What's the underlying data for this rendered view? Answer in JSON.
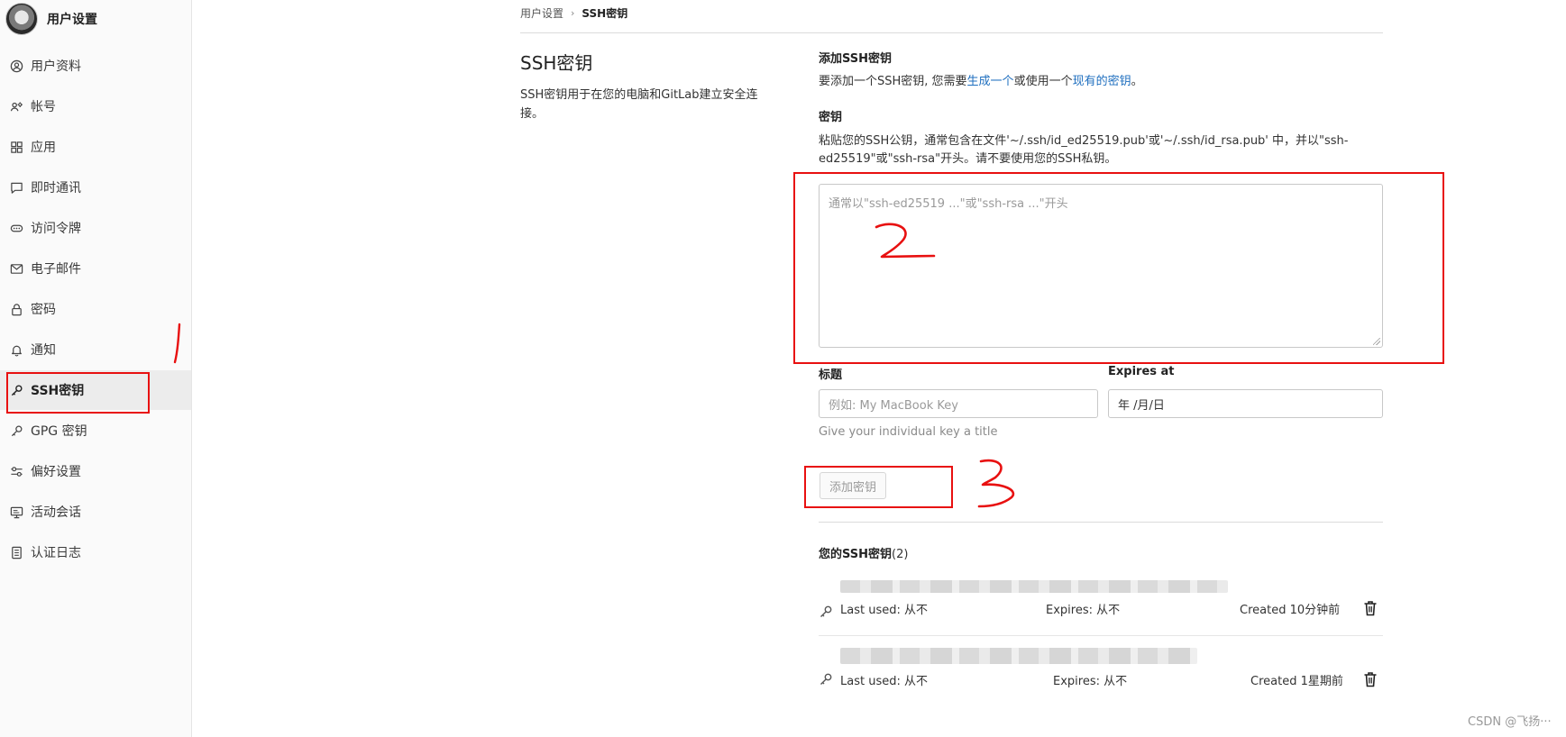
{
  "sidebar": {
    "title": "用户设置",
    "items": [
      {
        "label": "用户资料",
        "icon": "profile-icon"
      },
      {
        "label": "帐号",
        "icon": "account-icon"
      },
      {
        "label": "应用",
        "icon": "applications-icon"
      },
      {
        "label": "即时通讯",
        "icon": "chat-icon"
      },
      {
        "label": "访问令牌",
        "icon": "token-icon"
      },
      {
        "label": "电子邮件",
        "icon": "mail-icon"
      },
      {
        "label": "密码",
        "icon": "lock-icon"
      },
      {
        "label": "通知",
        "icon": "bell-icon"
      },
      {
        "label": "SSH密钥",
        "icon": "key-icon",
        "active": true
      },
      {
        "label": "GPG 密钥",
        "icon": "key-icon"
      },
      {
        "label": "偏好设置",
        "icon": "preferences-icon"
      },
      {
        "label": "活动会话",
        "icon": "monitor-icon"
      },
      {
        "label": "认证日志",
        "icon": "log-icon"
      }
    ]
  },
  "breadcrumb": {
    "parent": "用户设置",
    "current": "SSH密钥"
  },
  "intro": {
    "title": "SSH密钥",
    "description": "SSH密钥用于在您的电脑和GitLab建立安全连接。"
  },
  "add_key": {
    "heading": "添加SSH密钥",
    "text_prefix": "要添加一个SSH密钥, 您需要",
    "link_generate": "生成一个",
    "text_middle": "或使用一个",
    "link_existing": "现有的密钥",
    "text_suffix": "。",
    "key_label": "密钥",
    "key_help_line1": "粘贴您的SSH公钥，通常包含在文件'~/.ssh/id_ed25519.pub'或'~/.ssh/id_rsa.pub' 中，并以\"ssh-",
    "key_help_line2": "ed25519\"或\"ssh-rsa\"开头。请不要使用您的SSH私钥。",
    "key_placeholder": "通常以\"ssh-ed25519 ...\"或\"ssh-rsa ...\"开头",
    "title_label": "标题",
    "title_placeholder": "例如: My MacBook Key",
    "expires_label": "Expires at",
    "expires_value": "年 /月/日",
    "title_hint": "Give your individual key a title",
    "submit_label": "添加密钥"
  },
  "keys_list": {
    "heading": "您的SSH密钥",
    "count": "(2)",
    "keys": [
      {
        "last_used": "Last used: 从不",
        "expires": "Expires: 从不",
        "created": "Created 10分钟前"
      },
      {
        "last_used": "Last used: 从不",
        "expires": "Expires: 从不",
        "created": "Created 1星期前"
      }
    ]
  },
  "annotations": {
    "mark1": "1",
    "mark2": "2",
    "mark3": "3",
    "color": "#e81010"
  },
  "watermark": "CSDN @飞扬···"
}
